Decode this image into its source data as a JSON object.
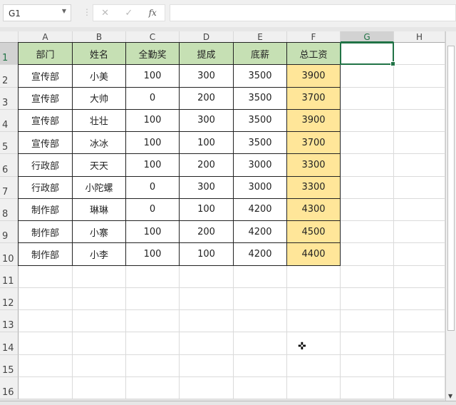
{
  "name_box": "G1",
  "formula_buttons": {
    "cancel": "✕",
    "enter": "✓",
    "fx": "fx"
  },
  "formula_value": "",
  "columns": [
    "A",
    "B",
    "C",
    "D",
    "E",
    "F",
    "G",
    "H"
  ],
  "rows": [
    "1",
    "2",
    "3",
    "4",
    "5",
    "6",
    "7",
    "8",
    "9",
    "10",
    "11",
    "12",
    "13",
    "14",
    "15",
    "16"
  ],
  "selected": {
    "column": "G",
    "row": "1"
  },
  "table": {
    "headers": [
      "部门",
      "姓名",
      "全勤奖",
      "提成",
      "底薪",
      "总工资"
    ],
    "data": [
      [
        "宣传部",
        "小美",
        "100",
        "300",
        "3500",
        "3900"
      ],
      [
        "宣传部",
        "大帅",
        "0",
        "200",
        "3500",
        "3700"
      ],
      [
        "宣传部",
        "壮壮",
        "100",
        "300",
        "3500",
        "3900"
      ],
      [
        "宣传部",
        "冰冰",
        "100",
        "100",
        "3500",
        "3700"
      ],
      [
        "行政部",
        "天天",
        "100",
        "200",
        "3000",
        "3300"
      ],
      [
        "行政部",
        "小陀螺",
        "0",
        "300",
        "3000",
        "3300"
      ],
      [
        "制作部",
        "琳琳",
        "0",
        "100",
        "4200",
        "4300"
      ],
      [
        "制作部",
        "小寨",
        "100",
        "200",
        "4200",
        "4500"
      ],
      [
        "制作部",
        "小李",
        "100",
        "100",
        "4200",
        "4400"
      ]
    ]
  },
  "colors": {
    "header_fill": "#c6e0b4",
    "total_fill": "#ffe699",
    "accent": "#217346"
  }
}
